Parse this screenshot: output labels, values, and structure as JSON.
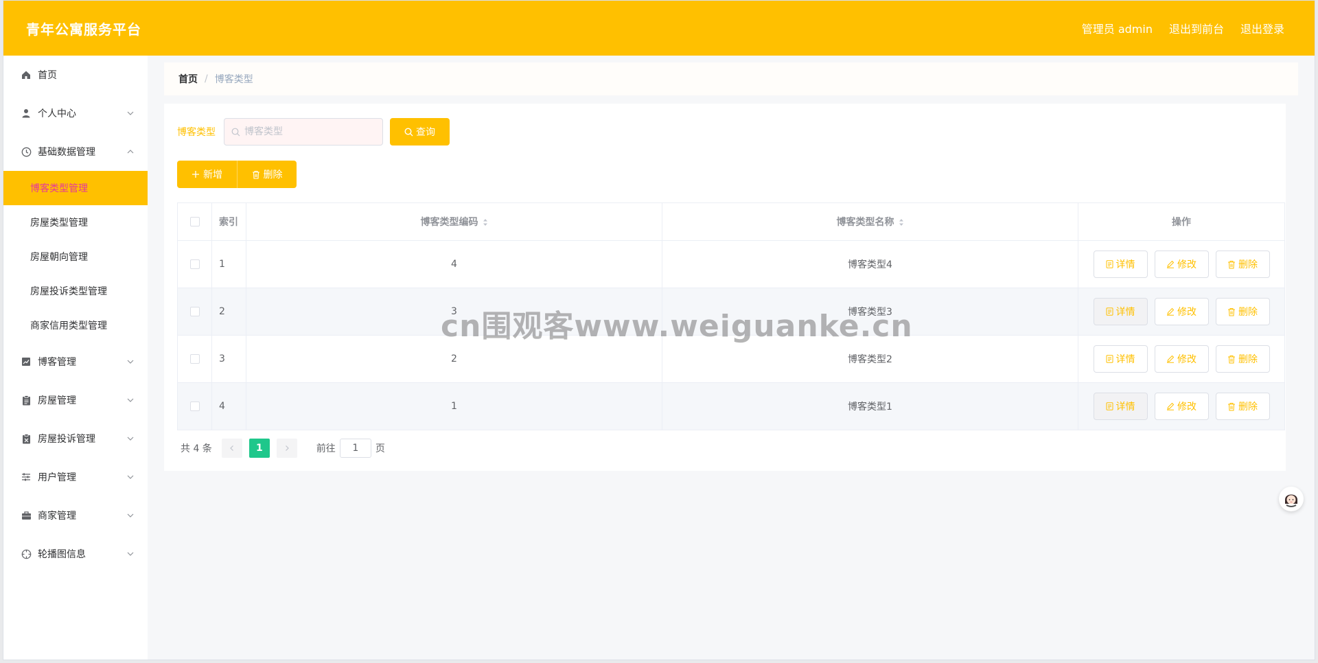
{
  "header": {
    "title": "青年公寓服务平台",
    "user_label": "管理员 admin",
    "to_front": "退出到前台",
    "logout": "退出登录"
  },
  "sidebar": {
    "items": [
      {
        "label": "首页",
        "icon": "home-icon"
      },
      {
        "label": "个人中心",
        "icon": "user-icon"
      },
      {
        "label": "基础数据管理",
        "icon": "clock-icon"
      },
      {
        "label": "博客管理",
        "icon": "chart-icon"
      },
      {
        "label": "房屋管理",
        "icon": "clipboard-icon"
      },
      {
        "label": "房屋投诉管理",
        "icon": "clipboard-x-icon"
      },
      {
        "label": "用户管理",
        "icon": "sliders-icon"
      },
      {
        "label": "商家管理",
        "icon": "briefcase-icon"
      },
      {
        "label": "轮播图信息",
        "icon": "target-icon"
      }
    ],
    "sub_items": [
      "博客类型管理",
      "房屋类型管理",
      "房屋朝向管理",
      "房屋投诉类型管理",
      "商家信用类型管理"
    ]
  },
  "breadcrumb": {
    "home": "首页",
    "separator": "/",
    "current": "博客类型"
  },
  "search": {
    "label": "博客类型",
    "placeholder": "博客类型",
    "button": "查询"
  },
  "actions": {
    "add": "新增",
    "delete": "删除"
  },
  "table": {
    "headers": {
      "index": "索引",
      "code": "博客类型编码",
      "name": "博客类型名称",
      "ops": "操作"
    },
    "rows": [
      {
        "index": "1",
        "code": "4",
        "name": "博客类型4"
      },
      {
        "index": "2",
        "code": "3",
        "name": "博客类型3"
      },
      {
        "index": "3",
        "code": "2",
        "name": "博客类型2"
      },
      {
        "index": "4",
        "code": "1",
        "name": "博客类型1"
      }
    ],
    "op_labels": {
      "detail": "详情",
      "edit": "修改",
      "delete": "删除"
    }
  },
  "pagination": {
    "total": "共 4 条",
    "current_page": "1",
    "goto": "前往",
    "page_value": "1",
    "page_unit": "页"
  },
  "watermark": "cn围观客www.weiguanke.cn",
  "colors": {
    "accent": "#ffc000",
    "active_text": "#e6399b",
    "pager_active": "#1fc78b"
  }
}
